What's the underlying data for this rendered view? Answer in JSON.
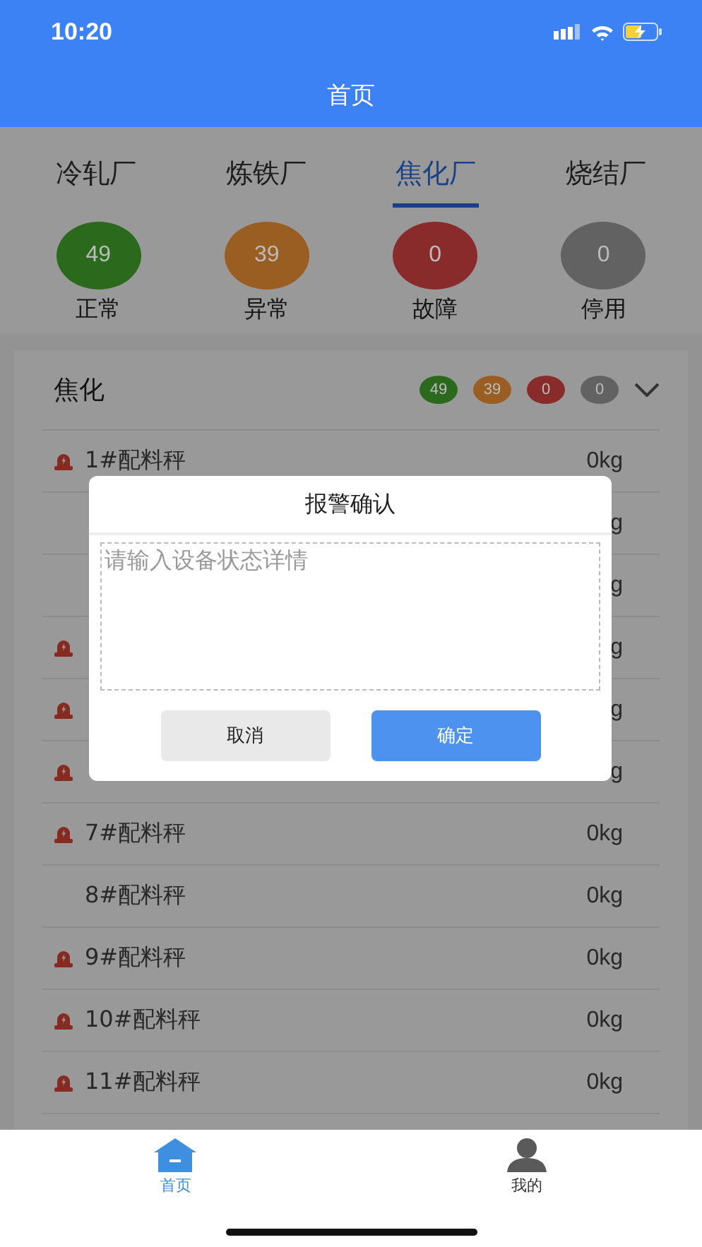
{
  "status_bar": {
    "time": "10:20"
  },
  "header": {
    "title": "首页"
  },
  "tabs": [
    {
      "label": "冷轧厂",
      "selected": false
    },
    {
      "label": "炼铁厂",
      "selected": false
    },
    {
      "label": "焦化厂",
      "selected": true
    },
    {
      "label": "烧结厂",
      "selected": false
    }
  ],
  "stats": [
    {
      "count": "49",
      "label": "正常",
      "color": "#2b6a1d"
    },
    {
      "count": "39",
      "label": "异常",
      "color": "#9a5e22"
    },
    {
      "count": "0",
      "label": "故障",
      "color": "#8a2b2b"
    },
    {
      "count": "0",
      "label": "停用",
      "color": "#626262"
    }
  ],
  "section": {
    "title": "焦化",
    "badges": [
      {
        "count": "49",
        "color": "#2b6a1d"
      },
      {
        "count": "39",
        "color": "#9a5e22"
      },
      {
        "count": "0",
        "color": "#8a2b2b"
      },
      {
        "count": "0",
        "color": "#626262"
      }
    ]
  },
  "rows": [
    {
      "name": "1#配料秤",
      "value": "0kg",
      "alarm": true
    },
    {
      "value": "g",
      "alarm": false
    },
    {
      "value": "g",
      "alarm": false
    },
    {
      "value": "g",
      "alarm": true
    },
    {
      "value": "g",
      "alarm": true
    },
    {
      "value": "g",
      "alarm": true
    },
    {
      "name": "7#配料秤",
      "value": "0kg",
      "alarm": true
    },
    {
      "name": "8#配料秤",
      "value": "0kg",
      "alarm": false
    },
    {
      "name": "9#配料秤",
      "value": "0kg",
      "alarm": true
    },
    {
      "name": "10#配料秤",
      "value": "0kg",
      "alarm": true
    },
    {
      "name": "11#配料秤",
      "value": "0kg",
      "alarm": true
    }
  ],
  "dialog": {
    "title": "报警确认",
    "placeholder": "请输入设备状态详情",
    "buttons": [
      {
        "label": "取消",
        "kind": "secondary"
      },
      {
        "label": "确定",
        "kind": "primary"
      }
    ]
  },
  "nav": [
    {
      "label": "首页",
      "kind": "home",
      "selected": true
    },
    {
      "label": "我的",
      "kind": "person",
      "selected": false
    }
  ]
}
